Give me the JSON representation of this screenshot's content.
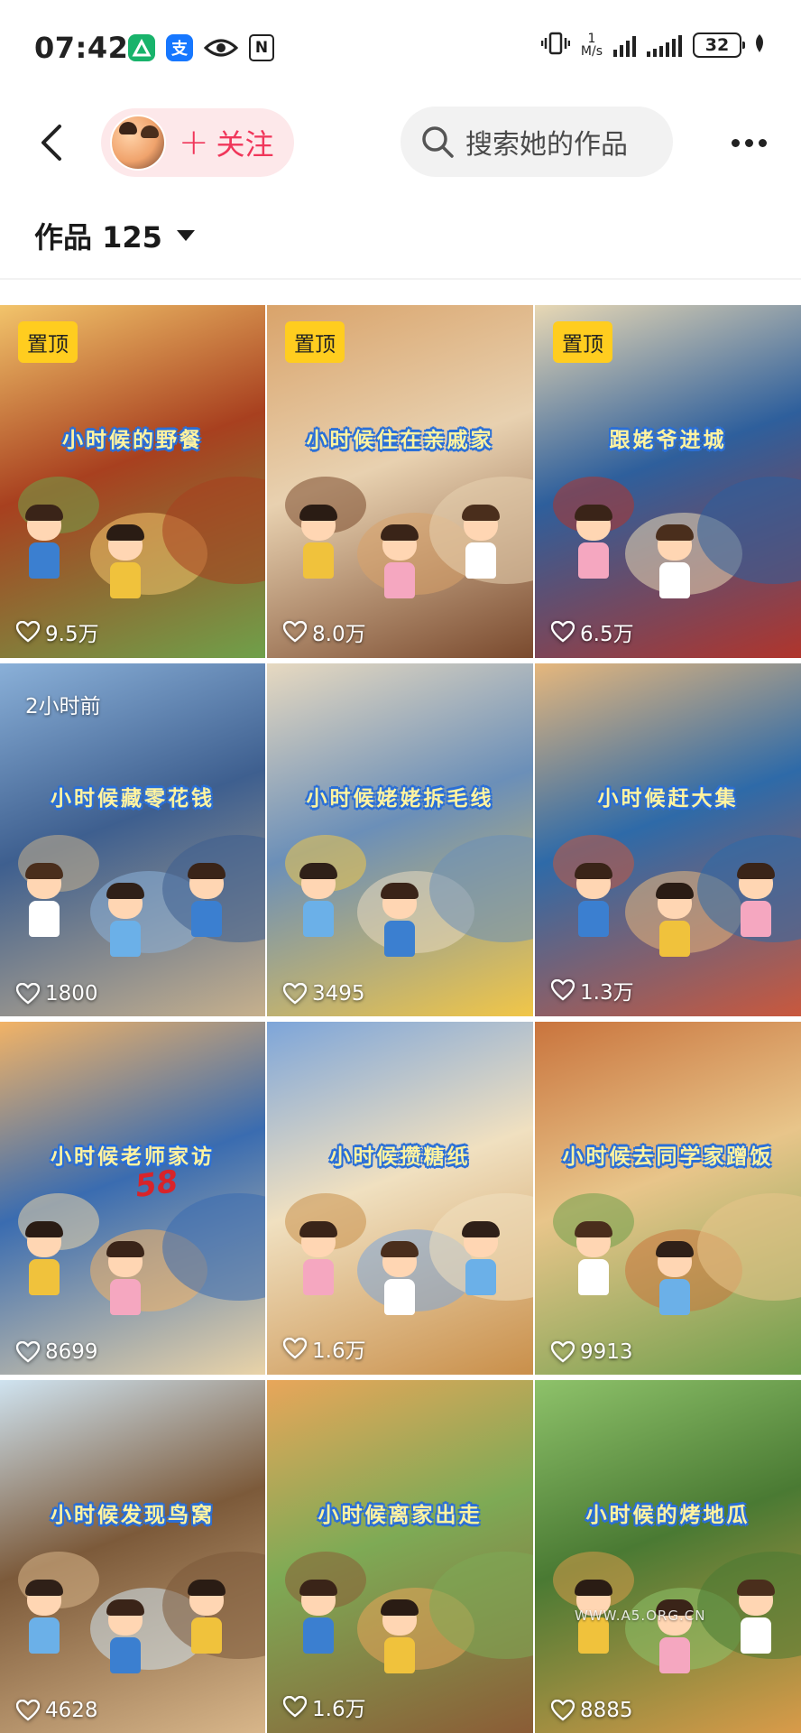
{
  "status_bar": {
    "time": "07:42",
    "net_speed_value": "1",
    "net_speed_unit": "M/s",
    "battery": "32",
    "app_icons": [
      "app-icon-green",
      "alipay-icon",
      "eye-icon",
      "nfc-icon"
    ]
  },
  "header": {
    "follow_label": "关注",
    "search_placeholder": "搜索她的作品"
  },
  "works": {
    "label": "作品 125"
  },
  "colors": {
    "follow_pink": "#f0365a",
    "follow_bg": "#fde8ea",
    "pin_yellow": "#ffcd1f",
    "title_blue": "#2b6fd6"
  },
  "tiles": [
    {
      "title": "小时候的野餐",
      "likes": "9.5万",
      "badge": "置顶",
      "time": ""
    },
    {
      "title": "小时候住在亲戚家",
      "likes": "8.0万",
      "badge": "置顶",
      "time": ""
    },
    {
      "title": "跟姥爷进城",
      "likes": "6.5万",
      "badge": "置顶",
      "time": ""
    },
    {
      "title": "小时候藏零花钱",
      "likes": "1800",
      "badge": "",
      "time": "2小时前"
    },
    {
      "title": "小时候姥姥拆毛线",
      "likes": "3495",
      "badge": "",
      "time": ""
    },
    {
      "title": "小时候赶大集",
      "likes": "1.3万",
      "badge": "",
      "time": ""
    },
    {
      "title": "小时候老师家访",
      "likes": "8699",
      "badge": "",
      "time": "",
      "extra": "58"
    },
    {
      "title": "小时候攒糖纸",
      "likes": "1.6万",
      "badge": "",
      "time": ""
    },
    {
      "title": "小时候去同学家蹭饭",
      "likes": "9913",
      "badge": "",
      "time": ""
    },
    {
      "title": "小时候发现鸟窝",
      "likes": "4628",
      "badge": "",
      "time": ""
    },
    {
      "title": "小时候离家出走",
      "likes": "1.6万",
      "badge": "",
      "time": ""
    },
    {
      "title": "小时候的烤地瓜",
      "likes": "8885",
      "badge": "",
      "time": "",
      "watermark": "WWW.A5.ORG.CN"
    }
  ]
}
